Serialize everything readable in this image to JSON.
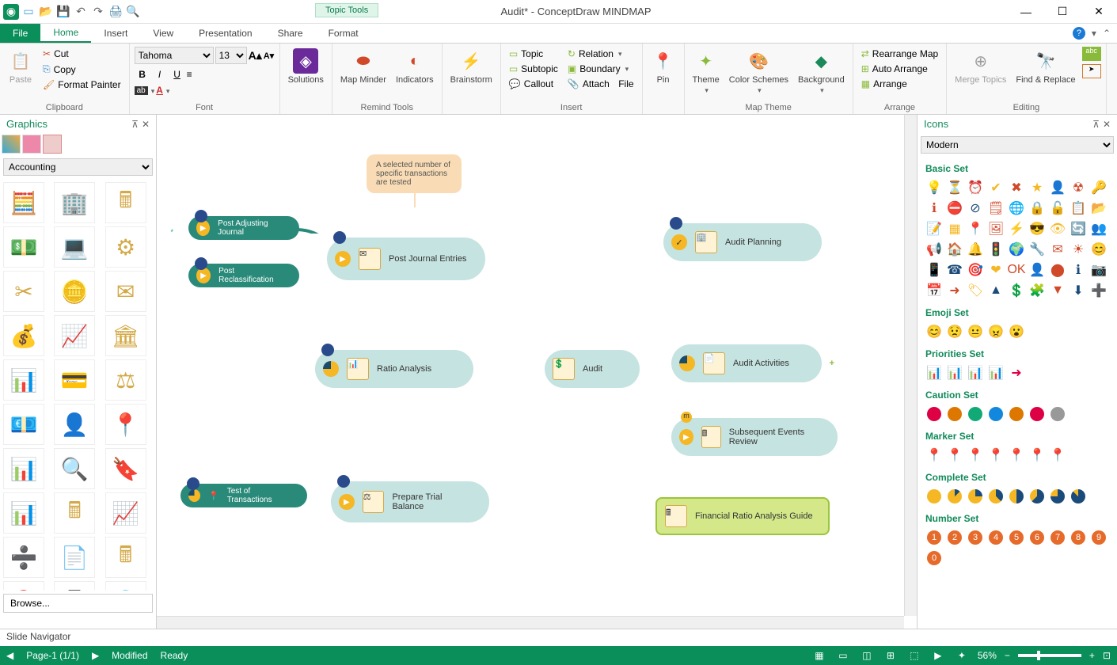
{
  "window": {
    "title": "Audit* - ConceptDraw MINDMAP",
    "context_tab": "Topic Tools"
  },
  "qat_icons": [
    "app-icon",
    "new-icon",
    "open-icon",
    "save-icon",
    "undo-icon",
    "redo-icon",
    "print-icon",
    "preview-icon"
  ],
  "tabs": {
    "file": "File",
    "items": [
      "Home",
      "Insert",
      "View",
      "Presentation",
      "Share",
      "Format"
    ],
    "active": "Home"
  },
  "ribbon": {
    "clipboard": {
      "label": "Clipboard",
      "paste": "Paste",
      "cut": "Cut",
      "copy": "Copy",
      "format_painter": "Format Painter"
    },
    "font": {
      "label": "Font",
      "family": "Tahoma",
      "size": "13"
    },
    "solutions": {
      "label": "Solutions"
    },
    "remind": {
      "label": "Remind Tools",
      "map_minder": "Map Minder",
      "indicators": "Indicators"
    },
    "brainstorm": {
      "label": "Brainstorm"
    },
    "insert": {
      "label": "Insert",
      "topic": "Topic",
      "subtopic": "Subtopic",
      "callout": "Callout",
      "relation": "Relation",
      "boundary": "Boundary",
      "attach": "Attach",
      "file": "File"
    },
    "pin": {
      "label": "Pin"
    },
    "theme": {
      "label": "Map Theme",
      "theme": "Theme",
      "color_schemes": "Color Schemes",
      "background": "Background"
    },
    "arrange": {
      "label": "Arrange",
      "rearrange": "Rearrange Map",
      "auto": "Auto Arrange",
      "arrange": "Arrange"
    },
    "editing": {
      "label": "Editing",
      "merge": "Merge Topics",
      "find": "Find & Replace"
    }
  },
  "graphics_panel": {
    "title": "Graphics",
    "category": "Accounting",
    "browse": "Browse..."
  },
  "icons_panel": {
    "title": "Icons",
    "style": "Modern",
    "sections": {
      "basic": "Basic Set",
      "emoji": "Emoji Set",
      "priorities": "Priorities Set",
      "caution": "Caution Set",
      "marker": "Marker Set",
      "complete": "Complete Set",
      "number": "Number Set"
    }
  },
  "mindmap": {
    "root": "Audit",
    "callout": "A selected number of specific transactions are tested",
    "left": [
      {
        "label": "Post Journal Entries",
        "children": [
          "Post Adjusting Journal",
          "Post Reclassification"
        ]
      },
      {
        "label": "Ratio Analysis"
      },
      {
        "label": "Prepare Trial Balance",
        "children": [
          "Test of Transactions"
        ]
      }
    ],
    "right": [
      {
        "label": "Audit Planning"
      },
      {
        "label": "Audit Activities"
      },
      {
        "label": "Subsequent Events Review"
      },
      {
        "label": "Financial Ratio Analysis Guide",
        "selected": true
      }
    ]
  },
  "slide_nav": "Slide Navigator",
  "status": {
    "page": "Page-1 (1/1)",
    "modified": "Modified",
    "ready": "Ready",
    "zoom": "56%"
  },
  "colors": {
    "accent": "#0a8f5b",
    "node": "#c5e3e0",
    "dark_node": "#2a8a7a",
    "selected": "#d4e88a"
  }
}
